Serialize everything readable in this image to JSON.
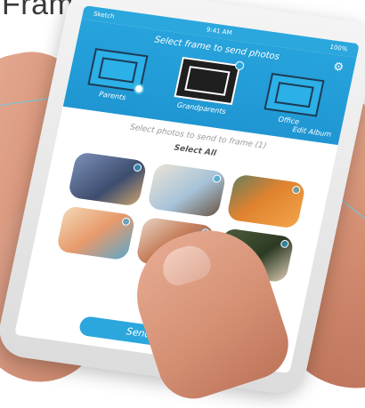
{
  "hero": {
    "title": "Frame"
  },
  "status": {
    "carrier": "Sketch",
    "time": "9:41 AM",
    "battery": "100%"
  },
  "app": {
    "title": "Select frame to send photos",
    "settings_icon": "gear-icon",
    "frames": [
      {
        "label": "Parents",
        "selected": false
      },
      {
        "label": "Grandparents",
        "selected": true
      },
      {
        "label": "Office",
        "selected": false
      }
    ],
    "edit_album": "Edit Album",
    "select_prompt": "Select photos to send to frame (1)",
    "select_all": "Select All",
    "photo_count": 6,
    "send_button": "Send Ph"
  },
  "colors": {
    "accent": "#2ba7dd",
    "callout": "#4fc0e4"
  }
}
